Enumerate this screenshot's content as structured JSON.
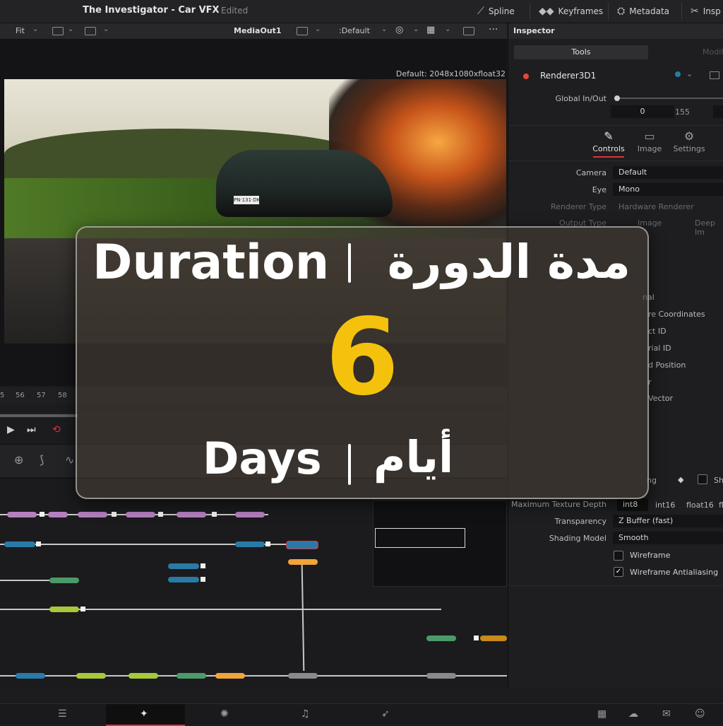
{
  "titlebar": {
    "project_title": "The Investigator - Car VFX",
    "status": "Edited",
    "tools": [
      {
        "label": "Spline",
        "icon": "spline-icon"
      },
      {
        "label": "Keyframes",
        "icon": "keyframes-icon"
      },
      {
        "label": "Metadata",
        "icon": "metadata-icon"
      },
      {
        "label": "Insp",
        "icon": "inspector-icon"
      }
    ]
  },
  "viewer_toolbar": {
    "zoom": "Fit",
    "node_name": "MediaOut1",
    "lut": ":Default"
  },
  "viewer": {
    "resolution_label": "Default: 2048x1080xfloat32",
    "plate_text": "PN·131·DK"
  },
  "ruler": {
    "ticks": [
      "5",
      "56",
      "57",
      "58"
    ]
  },
  "inspector": {
    "title": "Inspector",
    "tab_tools": "Tools",
    "tab_modifiers": "Modifi",
    "node_name": "Renderer3D1",
    "global_inout_label": "Global In/Out",
    "global_in": "0",
    "global_mid": "155",
    "subtabs": [
      "Controls",
      "Image",
      "Settings"
    ],
    "fields": [
      {
        "label": "Camera",
        "value": "Default",
        "dim": false
      },
      {
        "label": "Eye",
        "value": "Mono",
        "dim": false
      },
      {
        "label": "Renderer Type",
        "value": "Hardware Renderer",
        "dim": true
      },
      {
        "label": "Output Type",
        "value": "Image",
        "dim": true
      }
    ],
    "output_type_alt": "Deep Im",
    "partial_labels": [
      "nal",
      "re Coordinates",
      "ct ID",
      "rial ID",
      "d Position",
      "r",
      "Vector",
      "ng"
    ],
    "sh_label": "Sh",
    "texture_depth_label": "Maximum Texture Depth",
    "texture_depth_options": [
      "int8",
      "int16",
      "float16",
      "fl"
    ],
    "transparency_label": "Transparency",
    "transparency_value": "Z Buffer (fast)",
    "shading_label": "Shading Model",
    "shading_value": "Smooth",
    "wireframe_label": "Wireframe",
    "wireframe_checked": false,
    "wireframe_aa_label": "Wireframe Antialiasing",
    "wireframe_aa_checked": true
  },
  "overlay": {
    "heading_en": "Duration",
    "heading_ar": "مدة الدورة",
    "days_count": "6",
    "days_en": "Days",
    "days_ar": "أيام"
  },
  "colors": {
    "accent_yellow": "#f4c20d",
    "active_page_red": "#e0313a",
    "node_purple": "#b67fc0",
    "node_blue": "#2a7aa8",
    "node_green": "#4c9a6a",
    "node_lime": "#a6c83a",
    "node_orange": "#f0a43a"
  }
}
